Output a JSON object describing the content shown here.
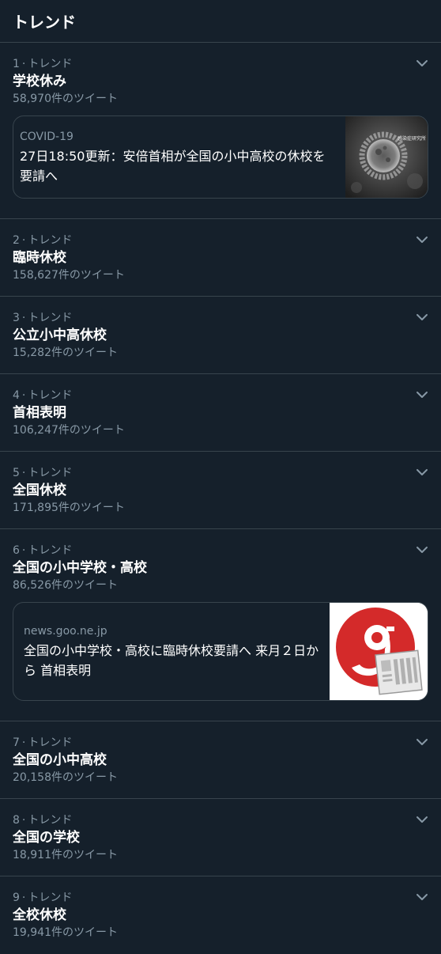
{
  "header": {
    "title": "トレンド"
  },
  "trends": [
    {
      "rank": "1",
      "category": "トレンド",
      "name": "学校休み",
      "count": "58,970件のツイート",
      "card": {
        "source": "COVID-19",
        "headline": "27日18:50更新：安倍首相が全国の小中高校の休校を要請へ",
        "image_caption": "感染症研究所"
      }
    },
    {
      "rank": "2",
      "category": "トレンド",
      "name": "臨時休校",
      "count": "158,627件のツイート"
    },
    {
      "rank": "3",
      "category": "トレンド",
      "name": "公立小中高休校",
      "count": "15,282件のツイート"
    },
    {
      "rank": "4",
      "category": "トレンド",
      "name": "首相表明",
      "count": "106,247件のツイート"
    },
    {
      "rank": "5",
      "category": "トレンド",
      "name": "全国休校",
      "count": "171,895件のツイート"
    },
    {
      "rank": "6",
      "category": "トレンド",
      "name": "全国の小中学校・高校",
      "count": "86,526件のツイート",
      "card": {
        "source": "news.goo.ne.jp",
        "headline": "全国の小中学校・高校に臨時休校要請へ 来月２日から 首相表明"
      }
    },
    {
      "rank": "7",
      "category": "トレンド",
      "name": "全国の小中高校",
      "count": "20,158件のツイート"
    },
    {
      "rank": "8",
      "category": "トレンド",
      "name": "全国の学校",
      "count": "18,911件のツイート"
    },
    {
      "rank": "9",
      "category": "トレンド",
      "name": "全校休校",
      "count": "19,941件のツイート"
    }
  ],
  "colors": {
    "background": "#15202b",
    "divider": "#38444d",
    "secondary_text": "#8899a6",
    "goo_red": "#d42a2a"
  },
  "icons": {
    "chevron": "chevron-down-icon",
    "card1_image": "coronavirus-micrograph",
    "card2_image": "goo-news-logo"
  }
}
